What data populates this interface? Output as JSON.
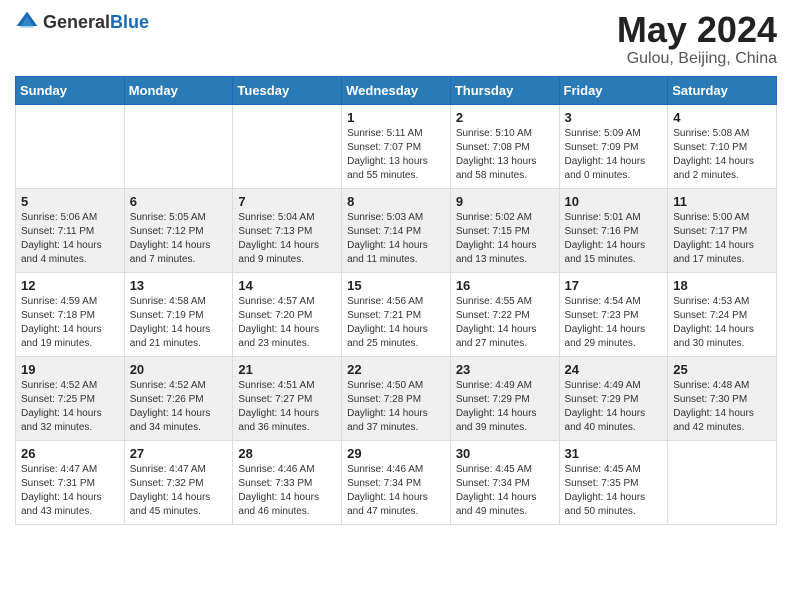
{
  "header": {
    "logo_general": "General",
    "logo_blue": "Blue",
    "main_title": "May 2024",
    "sub_title": "Gulou, Beijing, China"
  },
  "weekdays": [
    "Sunday",
    "Monday",
    "Tuesday",
    "Wednesday",
    "Thursday",
    "Friday",
    "Saturday"
  ],
  "weeks": [
    {
      "days": [
        {
          "number": "",
          "info": ""
        },
        {
          "number": "",
          "info": ""
        },
        {
          "number": "",
          "info": ""
        },
        {
          "number": "1",
          "info": "Sunrise: 5:11 AM\nSunset: 7:07 PM\nDaylight: 13 hours\nand 55 minutes."
        },
        {
          "number": "2",
          "info": "Sunrise: 5:10 AM\nSunset: 7:08 PM\nDaylight: 13 hours\nand 58 minutes."
        },
        {
          "number": "3",
          "info": "Sunrise: 5:09 AM\nSunset: 7:09 PM\nDaylight: 14 hours\nand 0 minutes."
        },
        {
          "number": "4",
          "info": "Sunrise: 5:08 AM\nSunset: 7:10 PM\nDaylight: 14 hours\nand 2 minutes."
        }
      ]
    },
    {
      "days": [
        {
          "number": "5",
          "info": "Sunrise: 5:06 AM\nSunset: 7:11 PM\nDaylight: 14 hours\nand 4 minutes."
        },
        {
          "number": "6",
          "info": "Sunrise: 5:05 AM\nSunset: 7:12 PM\nDaylight: 14 hours\nand 7 minutes."
        },
        {
          "number": "7",
          "info": "Sunrise: 5:04 AM\nSunset: 7:13 PM\nDaylight: 14 hours\nand 9 minutes."
        },
        {
          "number": "8",
          "info": "Sunrise: 5:03 AM\nSunset: 7:14 PM\nDaylight: 14 hours\nand 11 minutes."
        },
        {
          "number": "9",
          "info": "Sunrise: 5:02 AM\nSunset: 7:15 PM\nDaylight: 14 hours\nand 13 minutes."
        },
        {
          "number": "10",
          "info": "Sunrise: 5:01 AM\nSunset: 7:16 PM\nDaylight: 14 hours\nand 15 minutes."
        },
        {
          "number": "11",
          "info": "Sunrise: 5:00 AM\nSunset: 7:17 PM\nDaylight: 14 hours\nand 17 minutes."
        }
      ]
    },
    {
      "days": [
        {
          "number": "12",
          "info": "Sunrise: 4:59 AM\nSunset: 7:18 PM\nDaylight: 14 hours\nand 19 minutes."
        },
        {
          "number": "13",
          "info": "Sunrise: 4:58 AM\nSunset: 7:19 PM\nDaylight: 14 hours\nand 21 minutes."
        },
        {
          "number": "14",
          "info": "Sunrise: 4:57 AM\nSunset: 7:20 PM\nDaylight: 14 hours\nand 23 minutes."
        },
        {
          "number": "15",
          "info": "Sunrise: 4:56 AM\nSunset: 7:21 PM\nDaylight: 14 hours\nand 25 minutes."
        },
        {
          "number": "16",
          "info": "Sunrise: 4:55 AM\nSunset: 7:22 PM\nDaylight: 14 hours\nand 27 minutes."
        },
        {
          "number": "17",
          "info": "Sunrise: 4:54 AM\nSunset: 7:23 PM\nDaylight: 14 hours\nand 29 minutes."
        },
        {
          "number": "18",
          "info": "Sunrise: 4:53 AM\nSunset: 7:24 PM\nDaylight: 14 hours\nand 30 minutes."
        }
      ]
    },
    {
      "days": [
        {
          "number": "19",
          "info": "Sunrise: 4:52 AM\nSunset: 7:25 PM\nDaylight: 14 hours\nand 32 minutes."
        },
        {
          "number": "20",
          "info": "Sunrise: 4:52 AM\nSunset: 7:26 PM\nDaylight: 14 hours\nand 34 minutes."
        },
        {
          "number": "21",
          "info": "Sunrise: 4:51 AM\nSunset: 7:27 PM\nDaylight: 14 hours\nand 36 minutes."
        },
        {
          "number": "22",
          "info": "Sunrise: 4:50 AM\nSunset: 7:28 PM\nDaylight: 14 hours\nand 37 minutes."
        },
        {
          "number": "23",
          "info": "Sunrise: 4:49 AM\nSunset: 7:29 PM\nDaylight: 14 hours\nand 39 minutes."
        },
        {
          "number": "24",
          "info": "Sunrise: 4:49 AM\nSunset: 7:29 PM\nDaylight: 14 hours\nand 40 minutes."
        },
        {
          "number": "25",
          "info": "Sunrise: 4:48 AM\nSunset: 7:30 PM\nDaylight: 14 hours\nand 42 minutes."
        }
      ]
    },
    {
      "days": [
        {
          "number": "26",
          "info": "Sunrise: 4:47 AM\nSunset: 7:31 PM\nDaylight: 14 hours\nand 43 minutes."
        },
        {
          "number": "27",
          "info": "Sunrise: 4:47 AM\nSunset: 7:32 PM\nDaylight: 14 hours\nand 45 minutes."
        },
        {
          "number": "28",
          "info": "Sunrise: 4:46 AM\nSunset: 7:33 PM\nDaylight: 14 hours\nand 46 minutes."
        },
        {
          "number": "29",
          "info": "Sunrise: 4:46 AM\nSunset: 7:34 PM\nDaylight: 14 hours\nand 47 minutes."
        },
        {
          "number": "30",
          "info": "Sunrise: 4:45 AM\nSunset: 7:34 PM\nDaylight: 14 hours\nand 49 minutes."
        },
        {
          "number": "31",
          "info": "Sunrise: 4:45 AM\nSunset: 7:35 PM\nDaylight: 14 hours\nand 50 minutes."
        },
        {
          "number": "",
          "info": ""
        }
      ]
    }
  ]
}
